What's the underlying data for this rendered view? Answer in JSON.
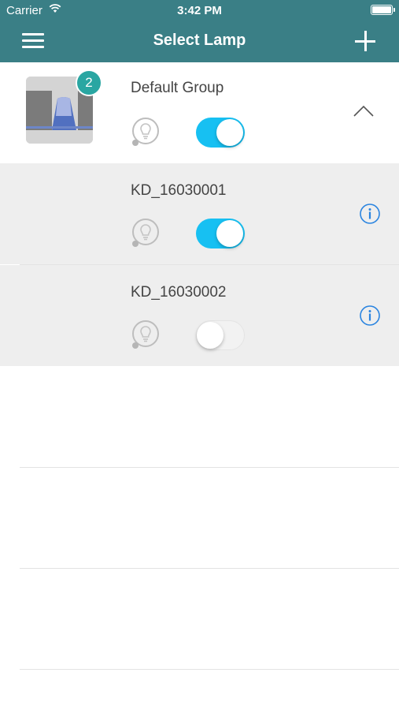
{
  "status_bar": {
    "carrier": "Carrier",
    "time": "3:42 PM"
  },
  "nav": {
    "title": "Select Lamp",
    "menu_icon": "hamburger-menu-icon",
    "add_icon": "plus-icon"
  },
  "group": {
    "name": "Default Group",
    "lamp_count": "2",
    "power_on": true,
    "expanded": true
  },
  "lamps": [
    {
      "name": "KD_16030001",
      "power_on": true
    },
    {
      "name": "KD_16030002",
      "power_on": false
    }
  ],
  "colors": {
    "header": "#3a7f86",
    "toggle_on": "#17c0f2",
    "badge": "#2aa6a2",
    "info": "#2a84e0",
    "row_bg": "#eeeeee"
  }
}
